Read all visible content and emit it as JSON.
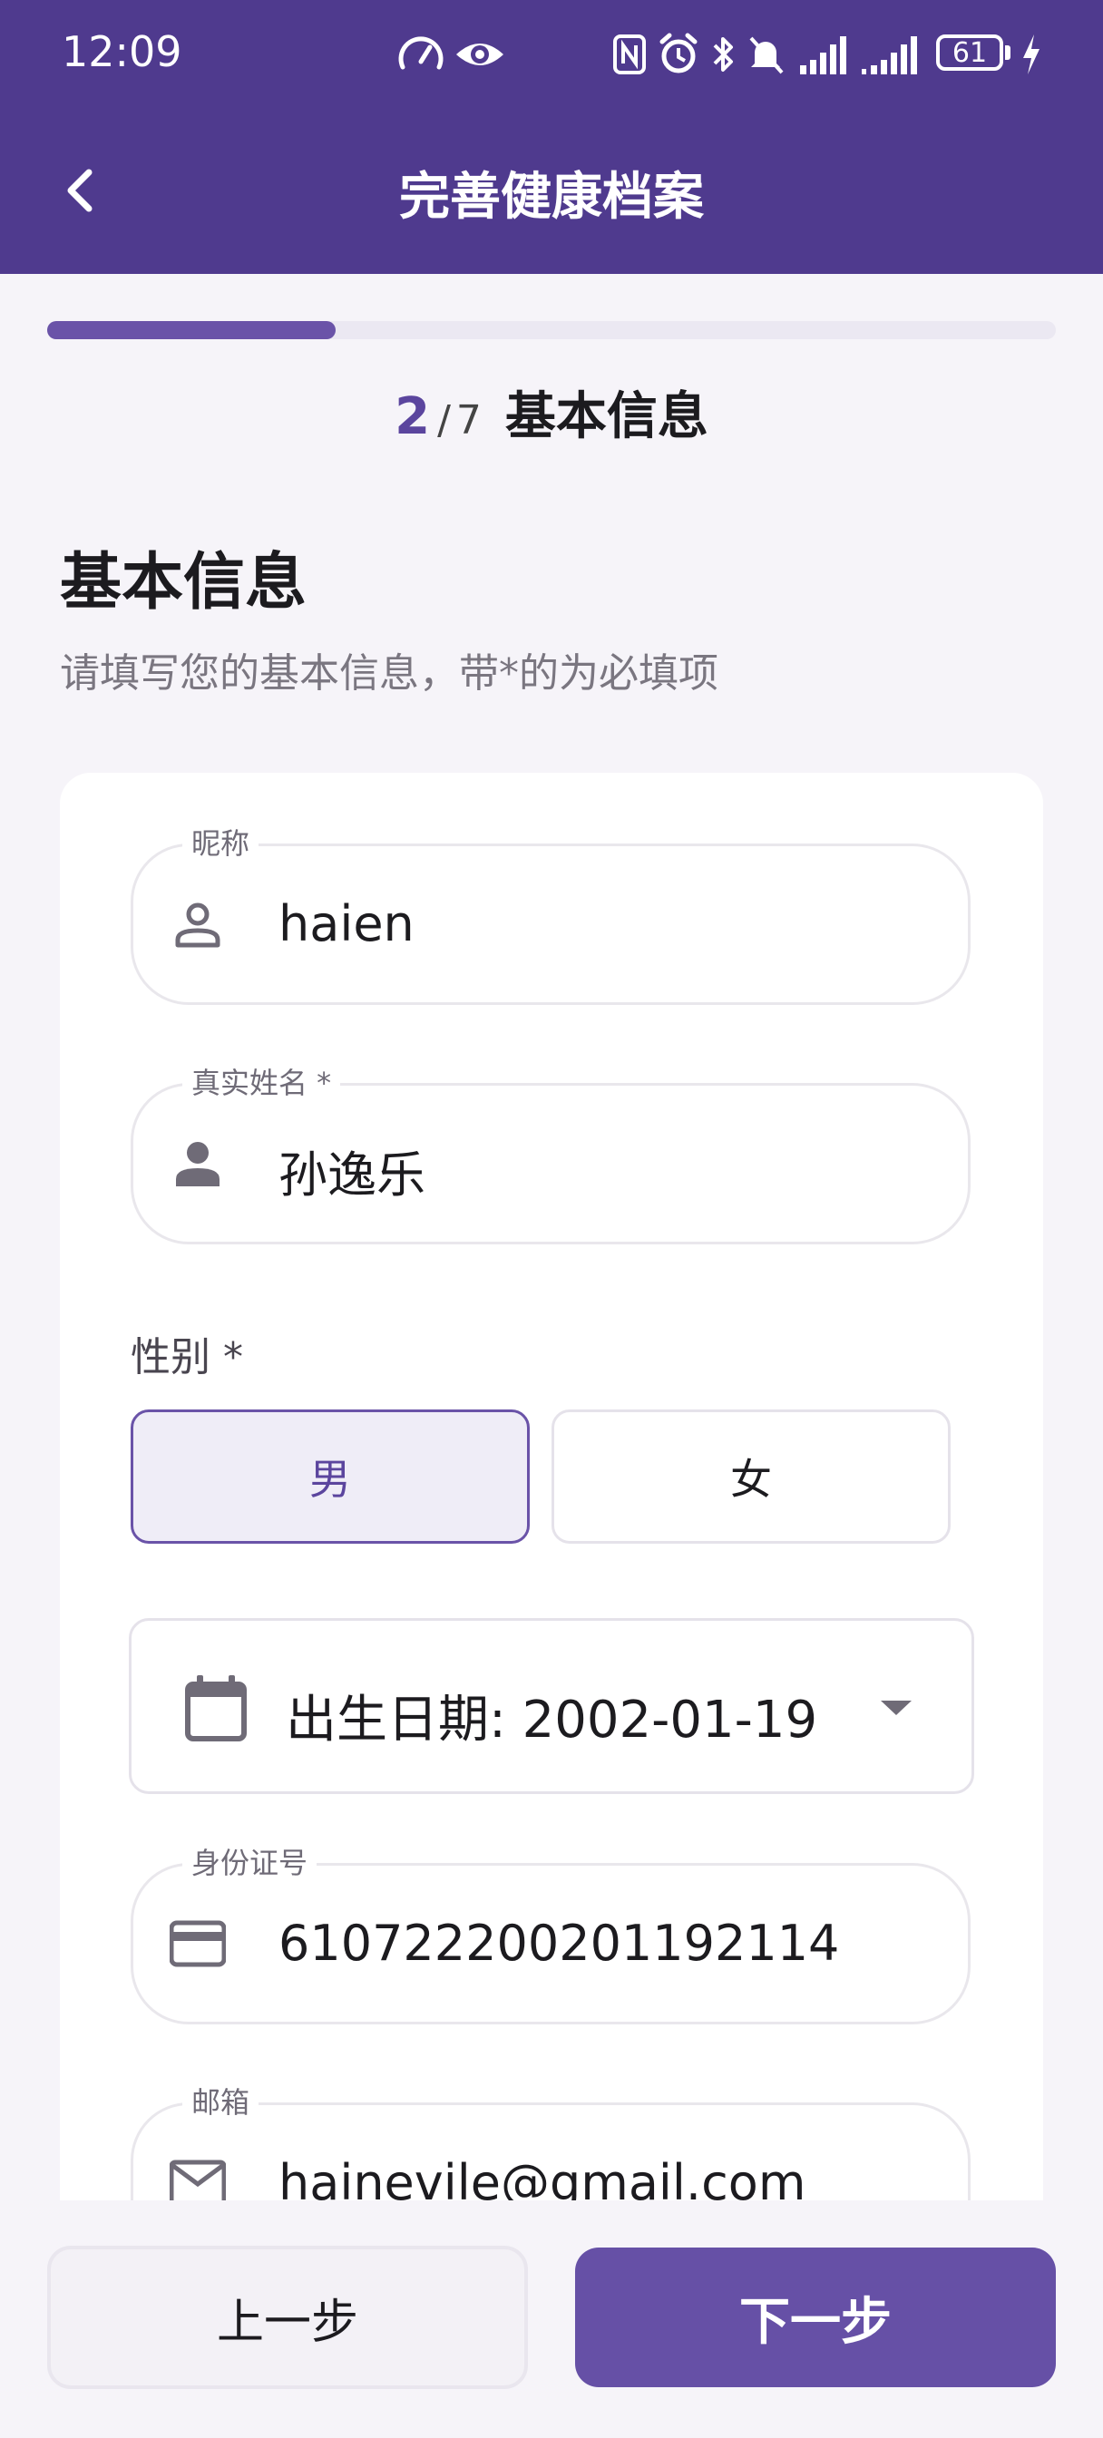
{
  "status_bar": {
    "time": "12:09",
    "battery": "61",
    "icons": [
      "speedometer-icon",
      "eye-icon",
      "nfc-icon",
      "alarm-icon",
      "bluetooth-icon",
      "mute-icon",
      "signal-icon",
      "signal-icon",
      "battery-icon",
      "charging-icon"
    ]
  },
  "header": {
    "title": "完善健康档案",
    "back_icon": "chevron-left-icon"
  },
  "progress": {
    "current": "2",
    "separator": "/",
    "total": "7",
    "step_title": "基本信息",
    "fraction": 0.2857
  },
  "section": {
    "title": "基本信息",
    "subtitle": "请填写您的基本信息，带*的为必填项"
  },
  "form": {
    "nickname": {
      "label": "昵称",
      "value": "haien",
      "icon": "person-outline-icon"
    },
    "real_name": {
      "label": "真实姓名 *",
      "value": "孙逸乐",
      "icon": "person-filled-icon"
    },
    "gender": {
      "label": "性别 *",
      "options": [
        "男",
        "女"
      ],
      "selected": "男"
    },
    "birth_date": {
      "text": "出生日期: 2002-01-19",
      "icon": "calendar-icon"
    },
    "id_number": {
      "label": "身份证号",
      "value": "610722200201192114",
      "icon": "credit-card-icon"
    },
    "email": {
      "label": "邮箱",
      "value": "hainevile@gmail.com",
      "icon": "mail-icon"
    }
  },
  "actions": {
    "prev": "上一步",
    "next": "下一步"
  },
  "colors": {
    "primary": "#4f3a8e",
    "accent": "#6650a6",
    "background": "#f6f4f9"
  }
}
